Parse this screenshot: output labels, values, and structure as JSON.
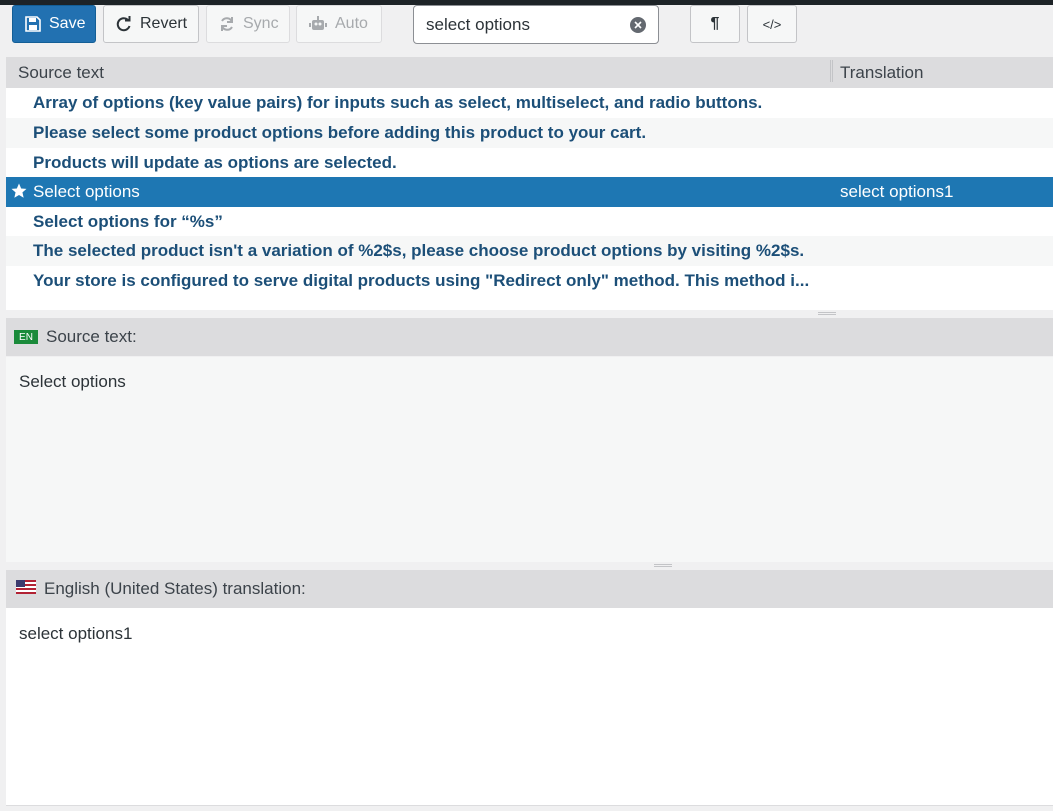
{
  "toolbar": {
    "save_label": "Save",
    "revert_label": "Revert",
    "sync_label": "Sync",
    "auto_label": "Auto",
    "search_value": "select options",
    "pilcrow_glyph": "¶",
    "code_glyph": "</>"
  },
  "grid": {
    "headers": [
      "Source text",
      "Translation"
    ],
    "rows": [
      {
        "source": "Array of options (key value pairs) for inputs such as select, multiselect, and radio buttons.",
        "translation": ""
      },
      {
        "source": "Please select some product options before adding this product to your cart.",
        "translation": ""
      },
      {
        "source": "Products will update as options are selected.",
        "translation": ""
      },
      {
        "source": "Select options",
        "translation": "select options1"
      },
      {
        "source": "Select options for “%s”",
        "translation": ""
      },
      {
        "source": "The selected product isn't a variation of %2$s, please choose product options by visiting %2$s.",
        "translation": ""
      },
      {
        "source": "Your store is configured to serve digital products using \"Redirect only\" method. This method i...",
        "translation": ""
      }
    ]
  },
  "source_pane": {
    "lang_badge": "EN",
    "header": "Source text:",
    "text": "Select options"
  },
  "target_pane": {
    "header": "English (United States) translation:",
    "text": "select options1"
  },
  "colors": {
    "primary": "#2271b1",
    "selected_row": "#1e77b3",
    "row_text": "#1c4f78"
  }
}
